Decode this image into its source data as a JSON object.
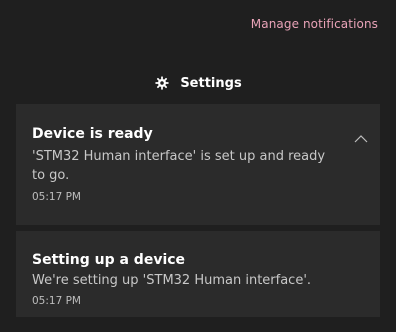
{
  "header": {
    "manage_label": "Manage notifications"
  },
  "app": {
    "name": "Settings",
    "icon": "gear-icon"
  },
  "notifications": [
    {
      "title": "Device is ready",
      "body": "'STM32 Human interface' is set up and ready to go.",
      "time": "05:17 PM",
      "toggle_icon": "chevron-up-icon"
    },
    {
      "title": "Setting up a device",
      "body": "We're setting up 'STM32 Human interface'.",
      "time": "05:17 PM"
    }
  ],
  "colors": {
    "background": "#1f1f1f",
    "card": "#2b2b2b",
    "accent_link": "#e9a3b8"
  }
}
